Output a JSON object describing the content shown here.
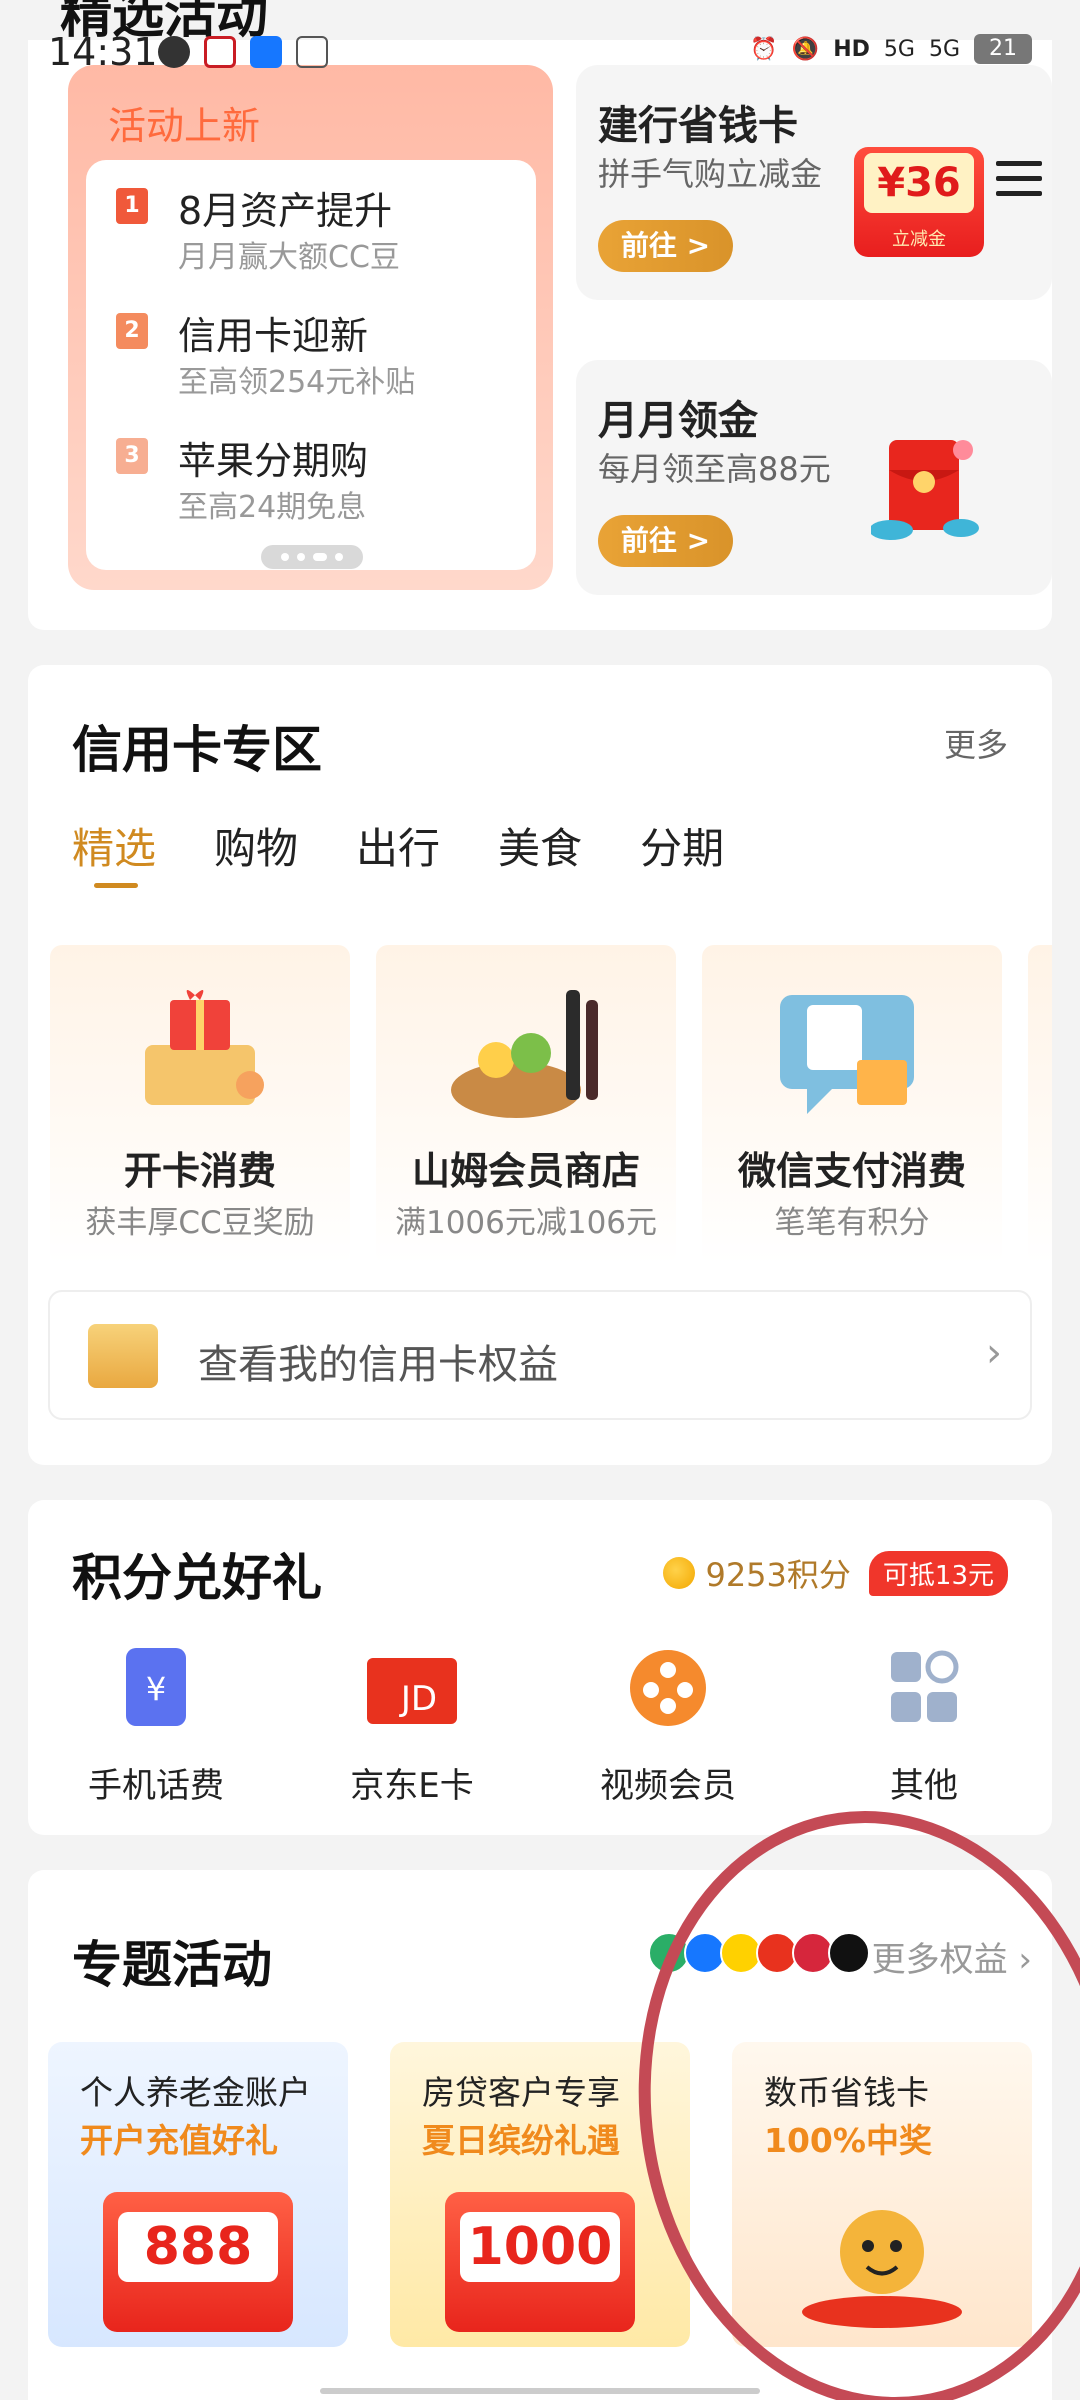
{
  "status_bar": {
    "time": "14:31",
    "cut_title": "精选活动",
    "signal_a": "5G",
    "signal_b": "5G",
    "battery": "21"
  },
  "top_activities": {
    "promo_title": "活动上新",
    "items": [
      {
        "num": "1",
        "title": "8月资产提升",
        "subtitle": "月月赢大额CC豆",
        "color": "#f0593a"
      },
      {
        "num": "2",
        "title": "信用卡迎新",
        "subtitle": "至高领254元补贴",
        "color": "#f48b5e"
      },
      {
        "num": "3",
        "title": "苹果分期购",
        "subtitle": "至高24期免息",
        "color": "#f7ae92"
      }
    ],
    "side_boxes": [
      {
        "title": "建行省钱卡",
        "subtitle": "拼手气购立减金",
        "button": "前往 >",
        "coupon_value": "¥36",
        "coupon_label": "立减金"
      },
      {
        "title": "月月领金",
        "subtitle": "每月领至高88元",
        "button": "前往 >"
      }
    ]
  },
  "credit_zone": {
    "title": "信用卡专区",
    "more": "更多",
    "tabs": [
      "精选",
      "购物",
      "出行",
      "美食",
      "分期"
    ],
    "offers": [
      {
        "title": "开卡消费",
        "subtitle": "获丰厚CC豆奖励"
      },
      {
        "title": "山姆会员商店",
        "subtitle": "满1006元减106元"
      },
      {
        "title": "微信支付消费",
        "subtitle": "笔笔有积分"
      }
    ],
    "benefit_text": "查看我的信用卡权益"
  },
  "points": {
    "title": "积分兑好礼",
    "balance": "9253积分",
    "deduct": "可抵13元",
    "gifts": [
      {
        "label": "手机话费",
        "icon": "phone-bill-icon"
      },
      {
        "label": "京东E卡",
        "icon": "jd-card-icon"
      },
      {
        "label": "视频会员",
        "icon": "video-member-icon"
      },
      {
        "label": "其他",
        "icon": "more-grid-icon"
      }
    ]
  },
  "topics": {
    "title": "专题活动",
    "more": "更多权益",
    "cards": [
      {
        "title": "个人养老金账户",
        "subtitle": "开户充值好礼",
        "amount": "888",
        "accent": "#f08a1d"
      },
      {
        "title": "房贷客户专享",
        "subtitle": "夏日缤纷礼遇",
        "amount": "1000",
        "accent": "#f08a1d"
      },
      {
        "title": "数币省钱卡",
        "subtitle": "100%中奖",
        "accent": "#f08a1d"
      }
    ]
  }
}
